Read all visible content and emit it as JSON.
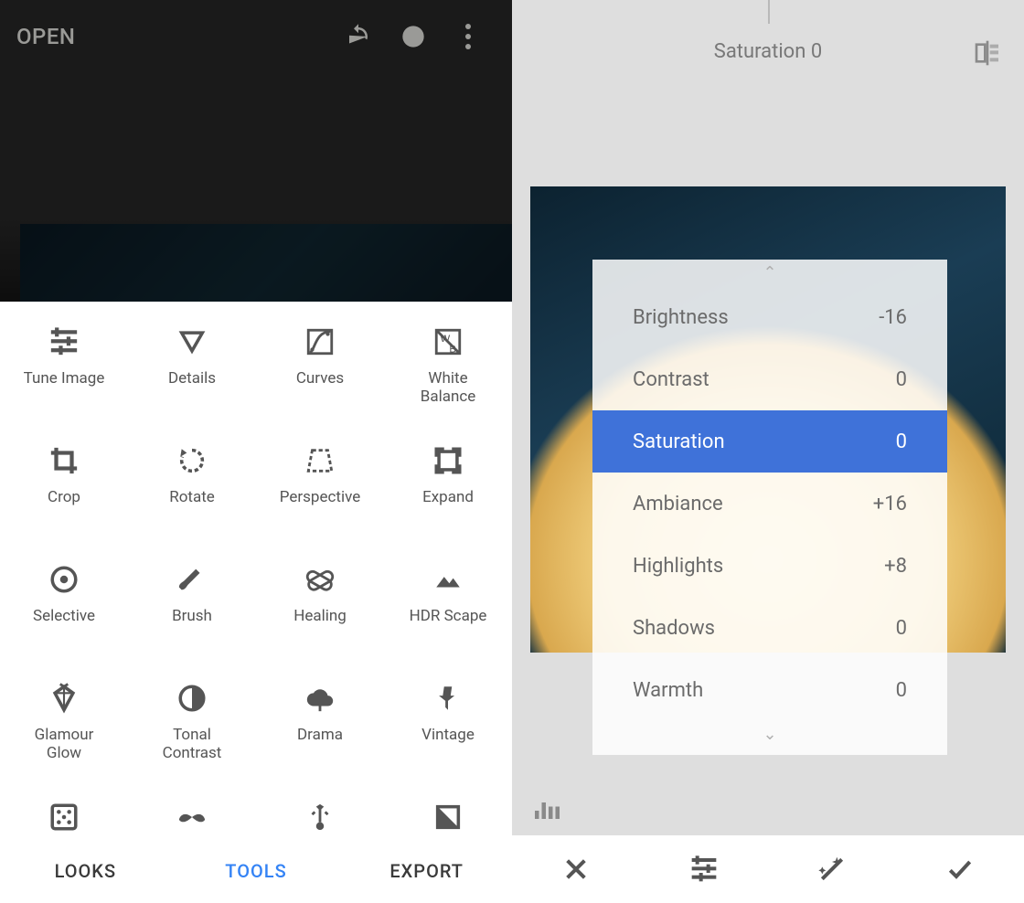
{
  "left": {
    "open_label": "OPEN",
    "tools": [
      {
        "id": "tune",
        "label": "Tune Image",
        "icon": "sliders"
      },
      {
        "id": "details",
        "label": "Details",
        "icon": "triangle-down"
      },
      {
        "id": "curves",
        "label": "Curves",
        "icon": "curves"
      },
      {
        "id": "wb",
        "label": "White\nBalance",
        "icon": "wb"
      },
      {
        "id": "crop",
        "label": "Crop",
        "icon": "crop"
      },
      {
        "id": "rotate",
        "label": "Rotate",
        "icon": "rotate"
      },
      {
        "id": "persp",
        "label": "Perspective",
        "icon": "perspective"
      },
      {
        "id": "expand",
        "label": "Expand",
        "icon": "expand"
      },
      {
        "id": "selective",
        "label": "Selective",
        "icon": "target"
      },
      {
        "id": "brush",
        "label": "Brush",
        "icon": "brush"
      },
      {
        "id": "healing",
        "label": "Healing",
        "icon": "bandage"
      },
      {
        "id": "hdr",
        "label": "HDR Scape",
        "icon": "mountains"
      },
      {
        "id": "glow",
        "label": "Glamour\nGlow",
        "icon": "diamond"
      },
      {
        "id": "tonal",
        "label": "Tonal\nContrast",
        "icon": "half-circle"
      },
      {
        "id": "drama",
        "label": "Drama",
        "icon": "cloud"
      },
      {
        "id": "vintage",
        "label": "Vintage",
        "icon": "pushpin"
      },
      {
        "id": "grainy",
        "label": "",
        "icon": "die-five"
      },
      {
        "id": "retro",
        "label": "",
        "icon": "moustache"
      },
      {
        "id": "grunge",
        "label": "",
        "icon": "guitar"
      },
      {
        "id": "bw",
        "label": "",
        "icon": "bw-square"
      }
    ],
    "tabs": [
      {
        "label": "LOOKS",
        "active": false
      },
      {
        "label": "TOOLS",
        "active": true
      },
      {
        "label": "EXPORT",
        "active": false
      }
    ]
  },
  "right": {
    "header": {
      "param": "Saturation",
      "value": "0"
    },
    "params": [
      {
        "name": "Brightness",
        "value": "-16",
        "selected": false
      },
      {
        "name": "Contrast",
        "value": "0",
        "selected": false
      },
      {
        "name": "Saturation",
        "value": "0",
        "selected": true
      },
      {
        "name": "Ambiance",
        "value": "+16",
        "selected": false
      },
      {
        "name": "Highlights",
        "value": "+8",
        "selected": false
      },
      {
        "name": "Shadows",
        "value": "0",
        "selected": false
      },
      {
        "name": "Warmth",
        "value": "0",
        "selected": false
      }
    ],
    "bottom_actions": [
      {
        "id": "close",
        "icon": "close"
      },
      {
        "id": "sliders",
        "icon": "sliders"
      },
      {
        "id": "magic",
        "icon": "magic"
      },
      {
        "id": "accept",
        "icon": "check"
      }
    ]
  }
}
